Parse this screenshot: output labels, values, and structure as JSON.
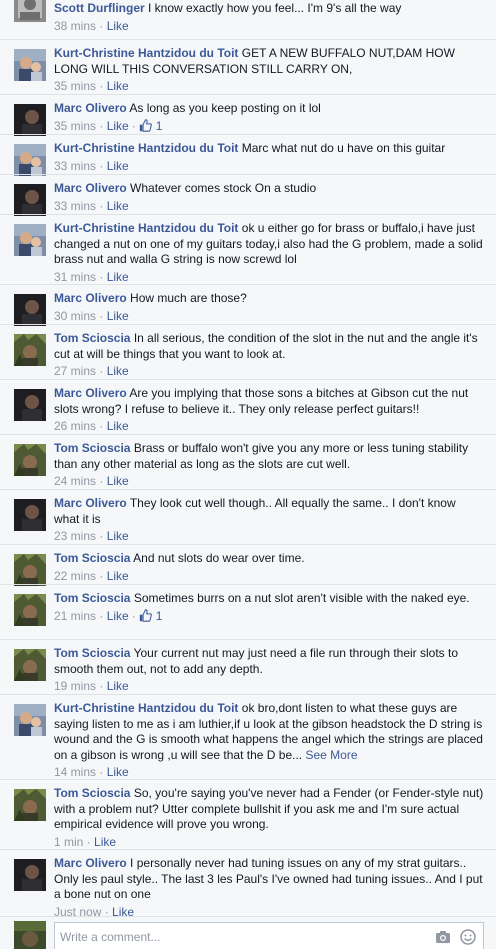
{
  "colors": {
    "link": "#3b5998",
    "meta": "#9197a3",
    "text": "#141823",
    "background": "#f6f7f9",
    "divider": "#e1e2e3"
  },
  "like_label": "Like",
  "separator": "·",
  "comments": [
    {
      "author": "Scott Durflinger",
      "text": "I know exactly how you feel... I'm 9's all the way",
      "time": "38 mins",
      "avatar": "avatar-gray"
    },
    {
      "author": "Kurt-Christine Hantzidou du Toit",
      "text": "GET A NEW BUFFALO NUT,DAM HOW LONG WILL THIS CONVERSATION STILL CARRY ON,",
      "time": "35 mins",
      "avatar": "avatar-kurt"
    },
    {
      "author": "Marc Olivero",
      "text": "As long as you keep posting on it lol",
      "time": "35 mins",
      "likes": "1",
      "avatar": "avatar-marc"
    },
    {
      "author": "Kurt-Christine Hantzidou du Toit",
      "text": "Marc what nut do u have on this guitar",
      "time": "33 mins",
      "avatar": "avatar-kurt"
    },
    {
      "author": "Marc Olivero",
      "text": "Whatever comes stock On a studio",
      "time": "33 mins",
      "avatar": "avatar-marc"
    },
    {
      "author": "Kurt-Christine Hantzidou du Toit",
      "text": "ok u either go for brass or buffalo,i have just changed a nut on one of my guitars today,i also had the G problem, made a solid brass nut and walla G string is now screwd lol",
      "time": "31 mins",
      "avatar": "avatar-kurt"
    },
    {
      "author": "Marc Olivero",
      "text": "How much are those?",
      "time": "30 mins",
      "avatar": "avatar-marc"
    },
    {
      "author": "Tom Scioscia",
      "text": "In all serious, the condition of the slot in the nut and the angle it's cut at will be things that you want to look at.",
      "time": "27 mins",
      "avatar": "avatar-tom"
    },
    {
      "author": "Marc Olivero",
      "text": "Are you implying that those sons a bitches at Gibson cut the nut slots wrong? I refuse to believe it.. They only release perfect guitars!!",
      "time": "26 mins",
      "avatar": "avatar-marc"
    },
    {
      "author": "Tom Scioscia",
      "text": "Brass or buffalo won't give you any more or less tuning stability than any other material as long as the slots are cut well.",
      "time": "24 mins",
      "avatar": "avatar-tom"
    },
    {
      "author": "Marc Olivero",
      "text": "They look cut well though.. All equally the same.. I don't know what it is",
      "time": "23 mins",
      "avatar": "avatar-marc"
    },
    {
      "author": "Tom Scioscia",
      "text": "And nut slots do wear over time.",
      "time": "22 mins",
      "avatar": "avatar-tom"
    },
    {
      "author": "Tom Scioscia",
      "text": "Sometimes burrs on a nut slot aren't visible with the naked eye.",
      "time": "21 mins",
      "likes": "1",
      "avatar": "avatar-tom"
    },
    {
      "author": "Tom Scioscia",
      "text": "Your current nut may just need a file run through their slots to smooth them out, not to add any depth.",
      "time": "19 mins",
      "avatar": "avatar-tom"
    },
    {
      "author": "Kurt-Christine Hantzidou du Toit",
      "text": "ok bro,dont listen to what these guys are saying listen to me as i am luthier,if u look at the gibson headstock the D string is wound and the G is smooth what happens the angel which the strings are placed on a gibson is wrong ,u will see that the D be...",
      "see_more": "See More",
      "time": "14 mins",
      "avatar": "avatar-kurt"
    },
    {
      "author": "Tom Scioscia",
      "text": "So, you're saying you've never had a Fender (or Fender-style nut) with a problem nut? Utter complete bullshit if you ask me and I'm sure actual empirical evidence will prove you wrong.",
      "time": "1 min",
      "avatar": "avatar-tom"
    },
    {
      "author": "Marc Olivero",
      "text": "I personally never had tuning issues on any of my strat guitars.. Only les paul style.. The last 3 les Paul's I've owned had tuning issues.. And I put a bone nut on one",
      "time": "Just now",
      "avatar": "avatar-marc"
    }
  ],
  "composer": {
    "placeholder": "Write a comment...",
    "camera_icon": "camera-icon",
    "emoji_icon": "smiley-icon"
  }
}
